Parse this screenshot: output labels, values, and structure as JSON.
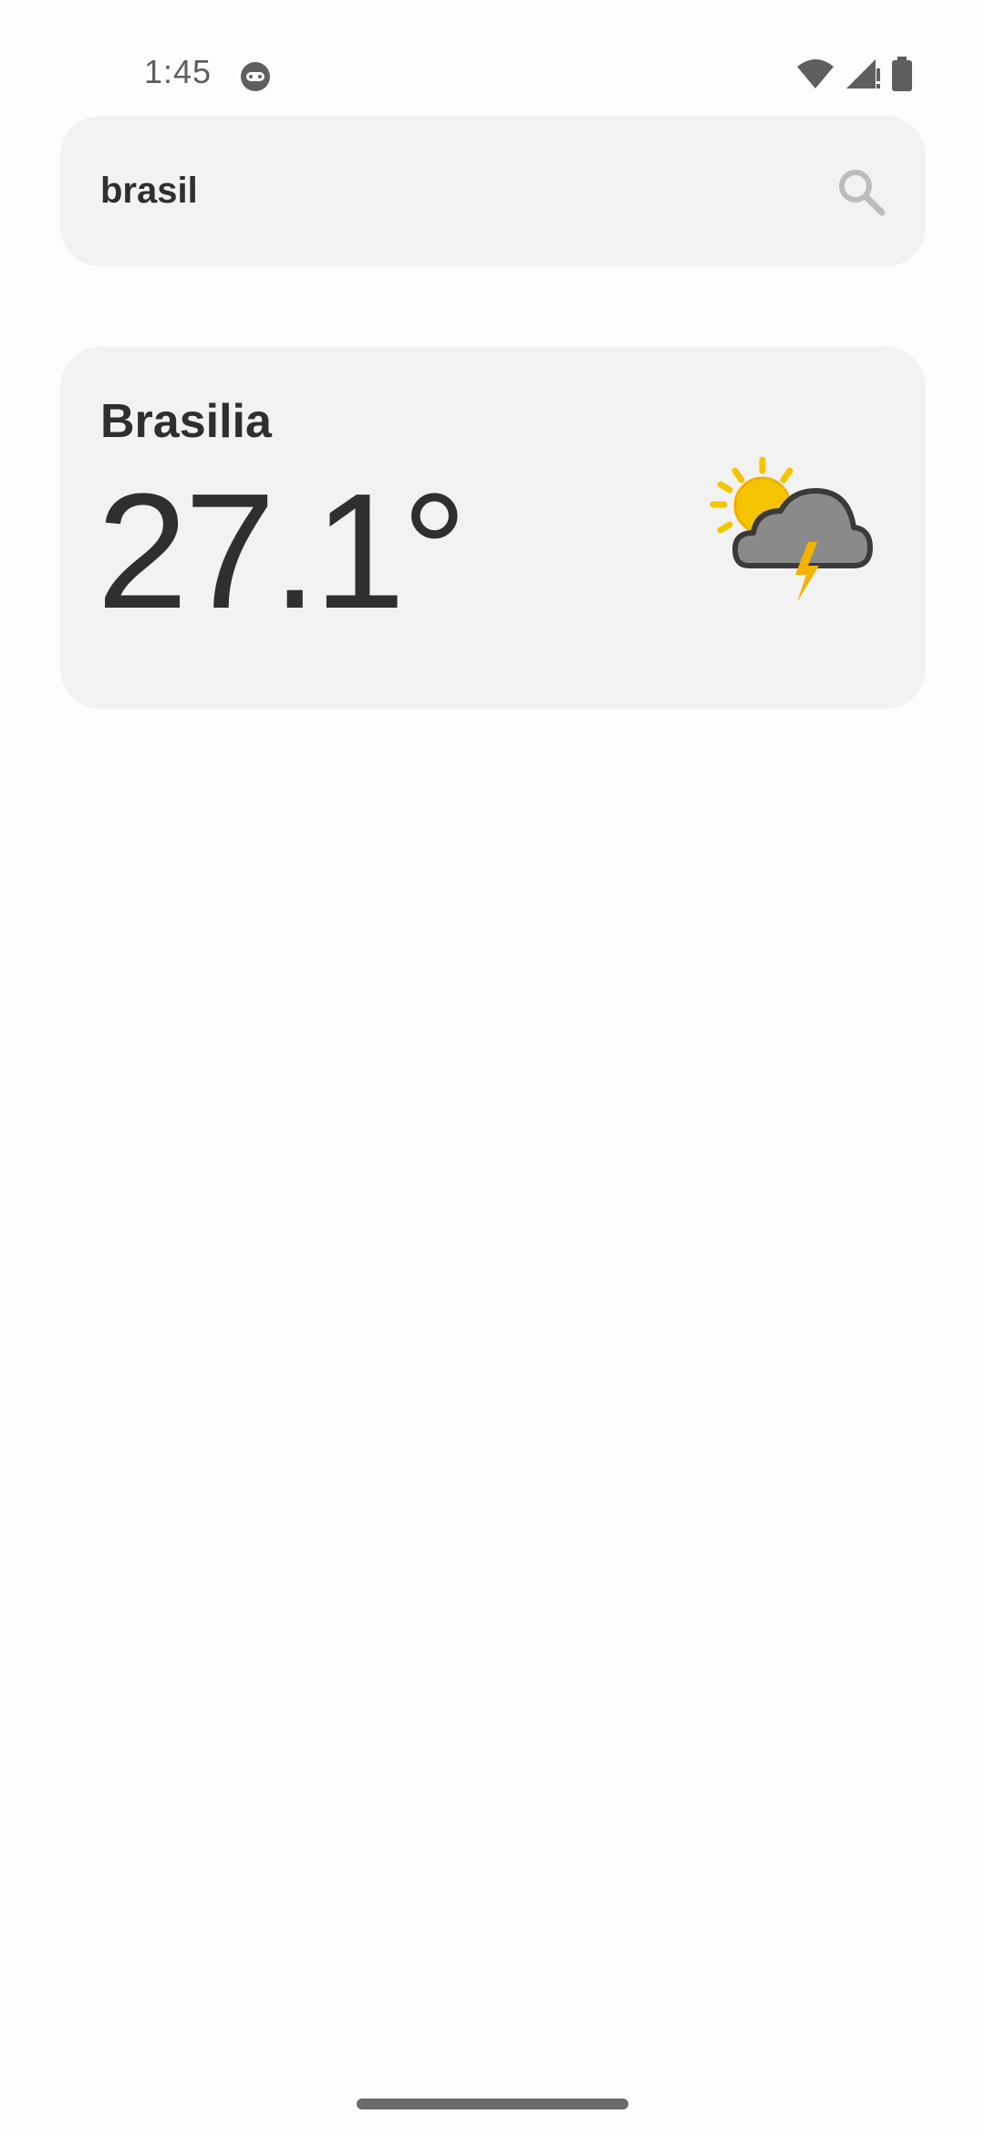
{
  "status_bar": {
    "time": "1:45",
    "notification_icon": "android-face-icon",
    "icons": [
      "wifi-icon",
      "signal-icon",
      "battery-icon"
    ]
  },
  "search": {
    "value": "brasil",
    "icon": "search-icon"
  },
  "weather_card": {
    "city": "Brasilia",
    "temperature": "27.1°",
    "condition_icon": "sun-cloud-thunder-icon"
  },
  "colors": {
    "background": "#fdfdfd",
    "card": "#f2f2f2",
    "text": "#2f2f2f",
    "sun": "#f5c400",
    "cloud": "#8a8a8a",
    "lightning": "#f2b300"
  }
}
